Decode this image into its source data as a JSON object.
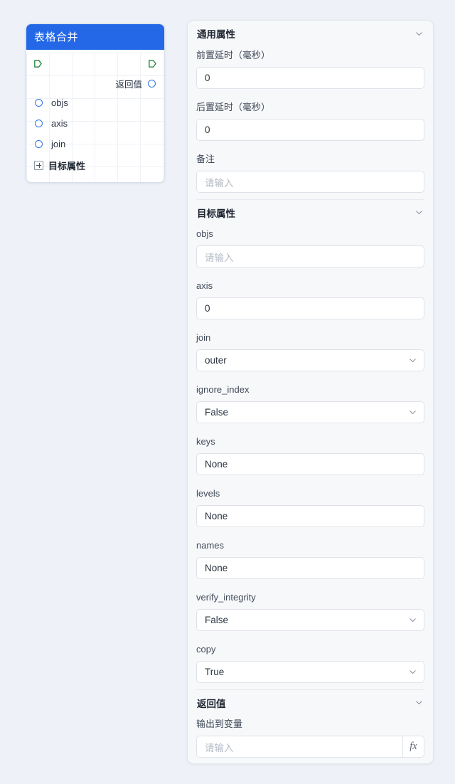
{
  "node": {
    "title": "表格合并",
    "flow_in_port": "flow-in",
    "flow_out_port": "flow-out",
    "return_label": "返回值",
    "inputs": [
      {
        "name": "objs"
      },
      {
        "name": "axis"
      },
      {
        "name": "join"
      }
    ],
    "expand_label": "目标属性",
    "expand_state": "collapsed"
  },
  "panel": {
    "sections": [
      {
        "id": "general",
        "title": "通用属性",
        "collapse_icon": "chevron-down-icon",
        "fields": [
          {
            "id": "pre_delay",
            "label": "前置延时（毫秒）",
            "type": "input",
            "value": "0",
            "placeholder": ""
          },
          {
            "id": "post_delay",
            "label": "后置延时（毫秒）",
            "type": "input",
            "value": "0",
            "placeholder": ""
          },
          {
            "id": "remark",
            "label": "备注",
            "type": "input",
            "value": "",
            "placeholder": "请输入"
          }
        ]
      },
      {
        "id": "target",
        "title": "目标属性",
        "collapse_icon": "chevron-down-icon",
        "fields": [
          {
            "id": "objs",
            "label": "objs",
            "type": "input",
            "value": "",
            "placeholder": "请输入"
          },
          {
            "id": "axis",
            "label": "axis",
            "type": "input",
            "value": "0",
            "placeholder": ""
          },
          {
            "id": "join",
            "label": "join",
            "type": "select",
            "value": "outer",
            "placeholder": ""
          },
          {
            "id": "ignore_index",
            "label": "ignore_index",
            "type": "select",
            "value": "False",
            "placeholder": ""
          },
          {
            "id": "keys",
            "label": "keys",
            "type": "input",
            "value": "None",
            "placeholder": ""
          },
          {
            "id": "levels",
            "label": "levels",
            "type": "input",
            "value": "None",
            "placeholder": ""
          },
          {
            "id": "names",
            "label": "names",
            "type": "input",
            "value": "None",
            "placeholder": ""
          },
          {
            "id": "verify_integrity",
            "label": "verify_integrity",
            "type": "select",
            "value": "False",
            "placeholder": ""
          },
          {
            "id": "copy",
            "label": "copy",
            "type": "select",
            "value": "True",
            "placeholder": ""
          }
        ]
      },
      {
        "id": "return",
        "title": "返回值",
        "collapse_icon": "chevron-down-icon",
        "fields": [
          {
            "id": "output_var",
            "label": "输出到变量",
            "type": "fx-input",
            "value": "",
            "placeholder": "请输入",
            "fx_label": "fx"
          }
        ]
      }
    ]
  },
  "colors": {
    "page_bg": "#eef1f8",
    "node_header": "#2468e8",
    "panel_bg": "#f7f8fa",
    "port_blue": "#2f74e0",
    "port_green": "#1f8a3d"
  }
}
